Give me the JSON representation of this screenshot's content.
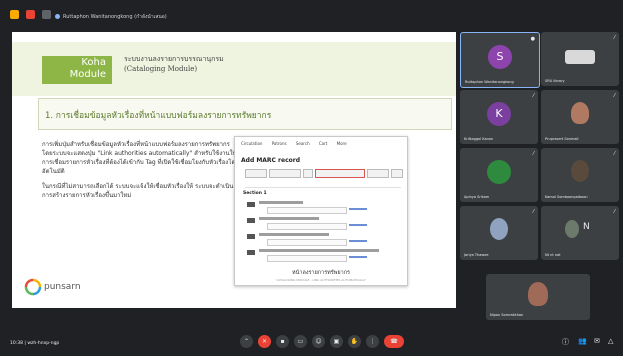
{
  "meeting": {
    "title_bar_text": "Ruttaphon Wanitanongkong (กำลังนำเสนอ)",
    "time_label": "10:38 | wzh-hnxp-ngp"
  },
  "slide": {
    "module_word1": "Koha",
    "module_word2": "Module",
    "module_title_th": "ระบบงานลงรายการบรรณานุกรม",
    "module_title_en": "(Cataloging Module)",
    "section_heading": "1. การเชื่อมข้อมูลหัวเรื่องที่หน้าแบบฟอร์มลงรายการทรัพยากร",
    "paragraph1": "การเพิ่มปุ่มสำหรับเชื่อมข้อมูลหัวเรื่องที่หน้าแบบฟอร์มลงรายการทรัพยากร โดยระบบจะแสดงปุ่ม \"Link authorities automatically\" สำหรับใช้งานในการเชื่อมรายการหัวเรื่องที่ต้องได้เข้ากับ Tag ที่เปิดใช้เชื่อมโยงกับหัวเรื่องโดยอัตโนมัติ",
    "paragraph2": "ในกรณีที่ไม่สามารถเลือกได้ ระบบจะแจ้งให้เชื่อมหัวเรื่องให้ ระบบจะดำเนินการสร้างรายการหัวเรื่องขึ้นมาใหม่",
    "brand": "punsarn",
    "koha_screenshot": {
      "tabs": [
        "Circulation",
        "Patrons",
        "Search",
        "Cart",
        "More"
      ],
      "title": "Add MARC record",
      "section_label": "Section 1",
      "caption": "หน้าลงรายการทรัพยากร",
      "caption_small": "CATALOGING MODULE - LINK AUTHORITIES AUTOMATICALLY"
    }
  },
  "participants": [
    {
      "name": "Ruttaphon Wanitanongkong",
      "initial": "S",
      "color": "#8e44ad"
    },
    {
      "name": "SRU library",
      "initial": "",
      "color": ""
    },
    {
      "name": "Krittaggol Kanon",
      "initial": "K",
      "color": "#7b3fa0"
    },
    {
      "name": "Pruprasert Sanmali",
      "initial": "",
      "color": ""
    },
    {
      "name": "Apinya Srikam",
      "initial": "",
      "color": "#2e8b3d"
    },
    {
      "name": "Kamol Somboonpaiboon",
      "initial": "",
      "color": ""
    },
    {
      "name": "Jariya Thawee",
      "initial": "",
      "color": ""
    },
    {
      "name": "Nt nt nat",
      "initial": "N",
      "color": ""
    },
    {
      "name": "Nipon Somrakkhan",
      "initial": "",
      "color": ""
    }
  ],
  "colors": {
    "background": "#202124",
    "tile": "#3c4043",
    "koha_green": "#8db646",
    "end_call": "#ea4335"
  }
}
